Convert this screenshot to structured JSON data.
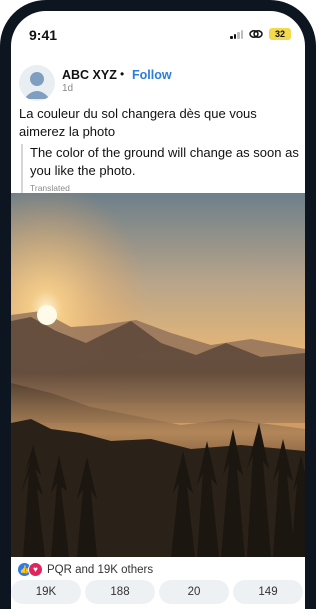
{
  "status_bar": {
    "time": "9:41",
    "battery": "32"
  },
  "post": {
    "author": "ABC XYZ",
    "separator": "•",
    "follow_label": "Follow",
    "age": "1d",
    "caption": "La couleur du sol changera dès que vous aimerez la photo",
    "translation": "The color of the ground will change as soon as you like the photo.",
    "translated_tag": "Translated"
  },
  "reactions": {
    "text": "PQR and 19K others"
  },
  "stats": [
    "19K",
    "188",
    "20",
    "149"
  ],
  "colors": {
    "accent": "#2a7de1",
    "frame": "#0c1520",
    "like": "#2a7de1",
    "love": "#e0245e"
  },
  "icons": [
    "signal-icon",
    "link-icon",
    "battery-icon",
    "like-reaction-icon",
    "love-reaction-icon"
  ]
}
